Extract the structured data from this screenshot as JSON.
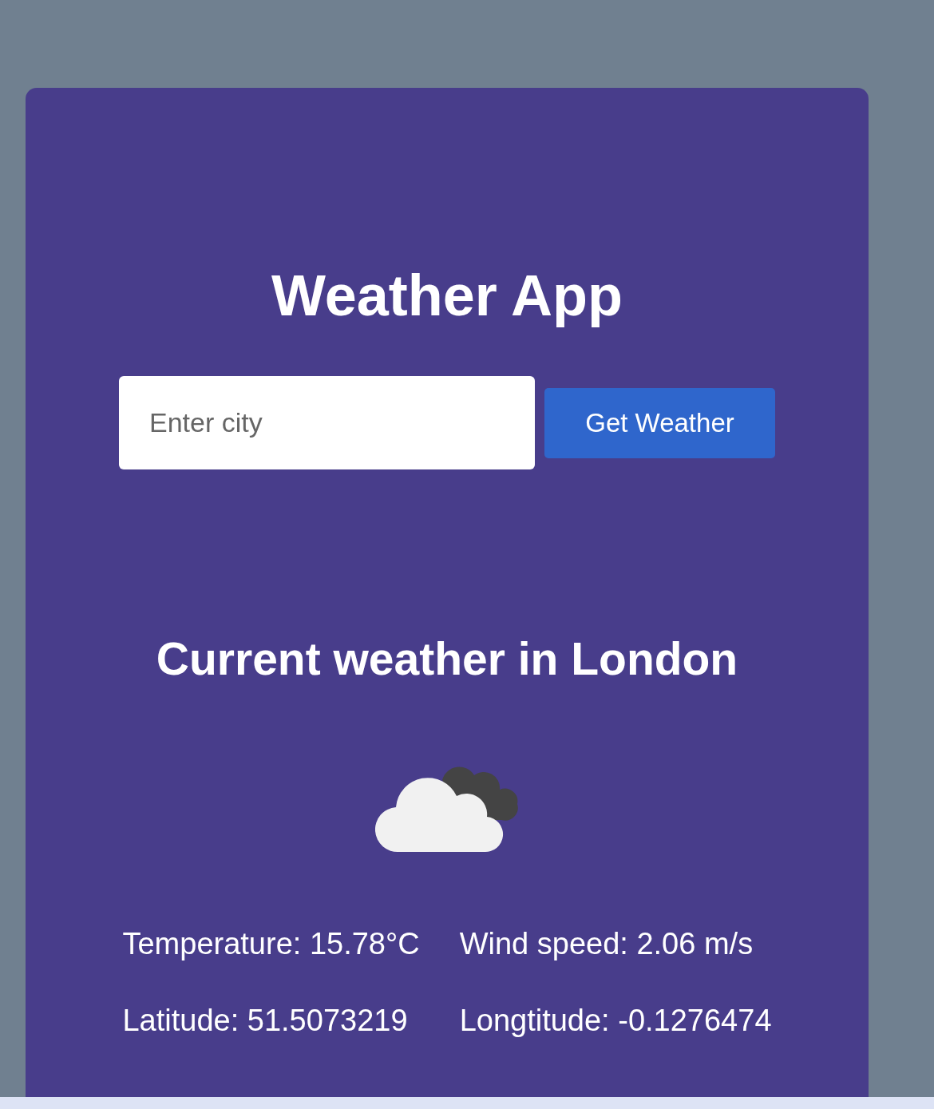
{
  "app": {
    "title": "Weather App"
  },
  "search": {
    "placeholder": "Enter city",
    "button": "Get Weather"
  },
  "weather": {
    "heading": "Current weather in London",
    "icon": {
      "kind": "clouds"
    },
    "stats": [
      {
        "text": "Temperature: 15.78°C"
      },
      {
        "text": "Wind speed: 2.06 m/s"
      },
      {
        "text": "Latitude: 51.5073219"
      },
      {
        "text": "Longtitude: -0.1276474"
      }
    ]
  }
}
